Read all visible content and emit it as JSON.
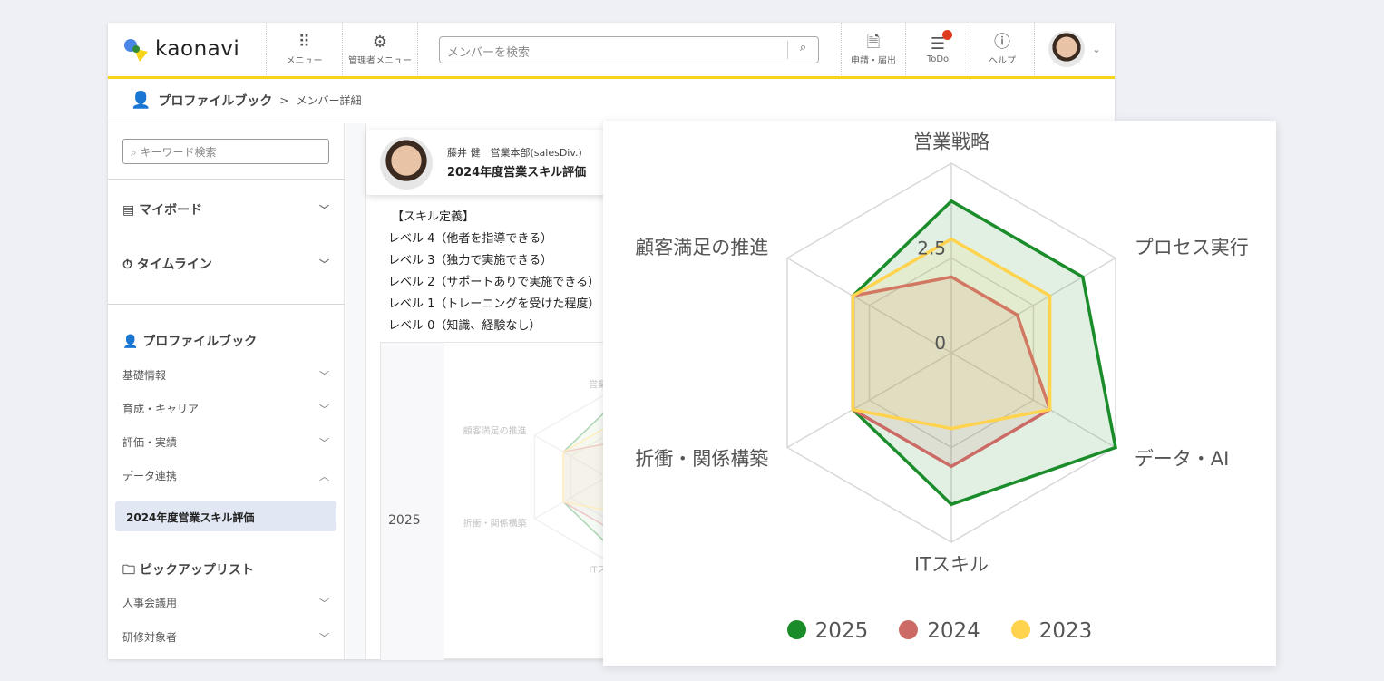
{
  "header": {
    "logo_text": "kaonavi",
    "menu_label": "メニュー",
    "admin_menu_label": "管理者メニュー",
    "search_placeholder": "メンバーを検索",
    "requests_label": "申請・届出",
    "todo_label": "ToDo",
    "help_label": "ヘルプ"
  },
  "breadcrumb": {
    "root": "プロファイルブック",
    "sep": ">",
    "current": "メンバー詳細"
  },
  "sidebar": {
    "keyword_placeholder": "キーワード検索",
    "myboard": "マイボード",
    "timeline": "タイムライン",
    "profilebook": "プロファイルブック",
    "profile_items": [
      "基礎情報",
      "育成・キャリア",
      "評価・実績",
      "データ連携"
    ],
    "active_item": "2024年度営業スキル評価",
    "picklist": "ピックアップリスト",
    "pick_items": [
      "人事会議用",
      "研修対象者"
    ]
  },
  "profile": {
    "name_dept": "藤井 健　営業本部(salesDiv.)",
    "sheet_title": "2024年度営業スキル評価"
  },
  "skill_defs": [
    "【スキル定義】",
    "レベル 4（他者を指導できる）",
    "レベル 3（独力で実施できる）",
    "レベル 2（サポートありで実施できる）",
    "レベル 1（トレーニングを受けた程度）",
    "レベル 0（知識、経験なし）"
  ],
  "table": {
    "row_year": "2025"
  },
  "chart_data": {
    "type": "radar",
    "axes": [
      "営業戦略",
      "プロセス実行",
      "データ・AI",
      "ITスキル",
      "折衝・関係構築",
      "顧客満足の推進"
    ],
    "scale": {
      "min": 0,
      "max": 5,
      "tick_labels": [
        "0",
        "2.5"
      ]
    },
    "series": [
      {
        "name": "2025",
        "color": "#1a8c2a",
        "values": [
          4,
          4,
          5,
          4,
          3,
          3
        ]
      },
      {
        "name": "2024",
        "color": "#cc6b66",
        "values": [
          2,
          2,
          3,
          3,
          3,
          3
        ]
      },
      {
        "name": "2023",
        "color": "#ffd34d",
        "values": [
          3,
          3,
          3,
          2,
          3,
          3
        ]
      }
    ],
    "legend": "bottom"
  }
}
